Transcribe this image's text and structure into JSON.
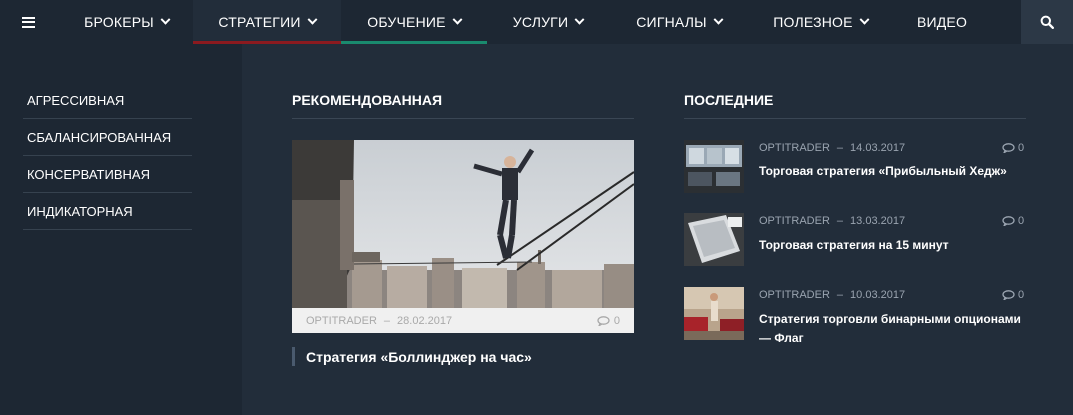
{
  "nav": {
    "items": [
      {
        "label": "Брокеры",
        "dropdown": true
      },
      {
        "label": "Стратегии",
        "dropdown": true,
        "active": true
      },
      {
        "label": "Обучение",
        "dropdown": true
      },
      {
        "label": "Услуги",
        "dropdown": true
      },
      {
        "label": "Сигналы",
        "dropdown": true
      },
      {
        "label": "Полезное",
        "dropdown": true
      },
      {
        "label": "Видео",
        "dropdown": false
      }
    ],
    "menu_icon": "hamburger-icon",
    "search_icon": "search-icon"
  },
  "sidebar": {
    "items": [
      {
        "label": "Агрессивная"
      },
      {
        "label": "Сбалансированная"
      },
      {
        "label": "Консервативная"
      },
      {
        "label": "Индикаторная"
      }
    ]
  },
  "featured": {
    "heading": "Рекомендованная",
    "author": "OPTITRADER",
    "separator": "–",
    "date": "28.02.2017",
    "comments": "0",
    "title": "Стратегия «Боллинджер на час»"
  },
  "latest": {
    "heading": "Последние",
    "posts": [
      {
        "author": "OPTITRADER",
        "separator": "–",
        "date": "14.03.2017",
        "comments": "0",
        "title": "Торговая стратегия «Прибыльный Хедж»"
      },
      {
        "author": "OPTITRADER",
        "separator": "–",
        "date": "13.03.2017",
        "comments": "0",
        "title": "Торговая стратегия на 15 минут"
      },
      {
        "author": "OPTITRADER",
        "separator": "–",
        "date": "10.03.2017",
        "comments": "0",
        "title": "Стратегия торговли бинарными опционами — Флаг"
      }
    ]
  },
  "colors": {
    "active_underline": "#8b1a1f",
    "secondary_underline": "#1a8a6e"
  }
}
